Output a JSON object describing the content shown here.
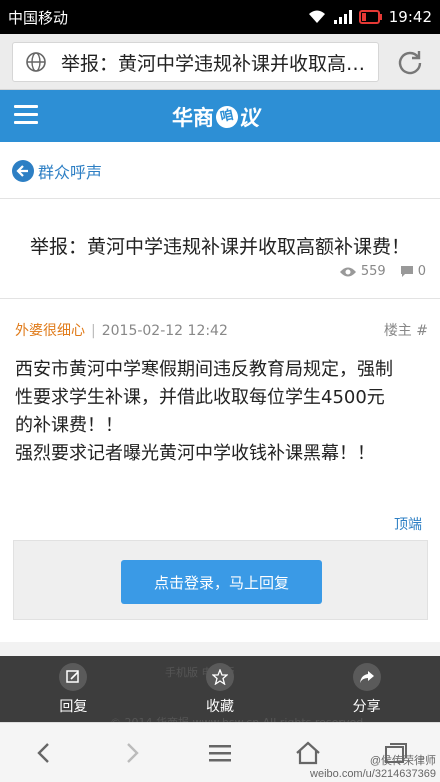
{
  "status_bar": {
    "carrier": "中国移动",
    "time": "19:42"
  },
  "browser": {
    "url_text": "举报：黄河中学违规补课并收取高…"
  },
  "header": {
    "brand": "华商",
    "brand_bubble": "咱",
    "brand_tail": "议"
  },
  "breadcrumb": {
    "label": "群众呼声"
  },
  "post": {
    "title": "举报：黄河中学违规补课并收取高额补课费！",
    "views": "559",
    "comments": "0",
    "author": "外婆很细心",
    "date": "2015-02-12 12:42",
    "floor": "楼主 #",
    "body_lines": [
      "西安市黄河中学寒假期间违反教育局规定，强制",
      "性要求学生补课，并借此收取每位学生4500元",
      "的补课费！！",
      "强烈要求记者曝光黄河中学收钱补课黑幕！！"
    ],
    "top_link": "顶端",
    "login_button": "点击登录，马上回复"
  },
  "footer": {
    "bg_links": "手机版   电脑版",
    "bg_copyright": "© 2014 华商报 www.hsw.cn All rights reserved",
    "actions": [
      {
        "label": "回复",
        "icon": "edit-icon"
      },
      {
        "label": "收藏",
        "icon": "star-icon"
      },
      {
        "label": "分享",
        "icon": "share-icon"
      }
    ]
  },
  "watermark": "weibo.com/u/3214637369",
  "watermark_handle": "@侯传荣律师"
}
